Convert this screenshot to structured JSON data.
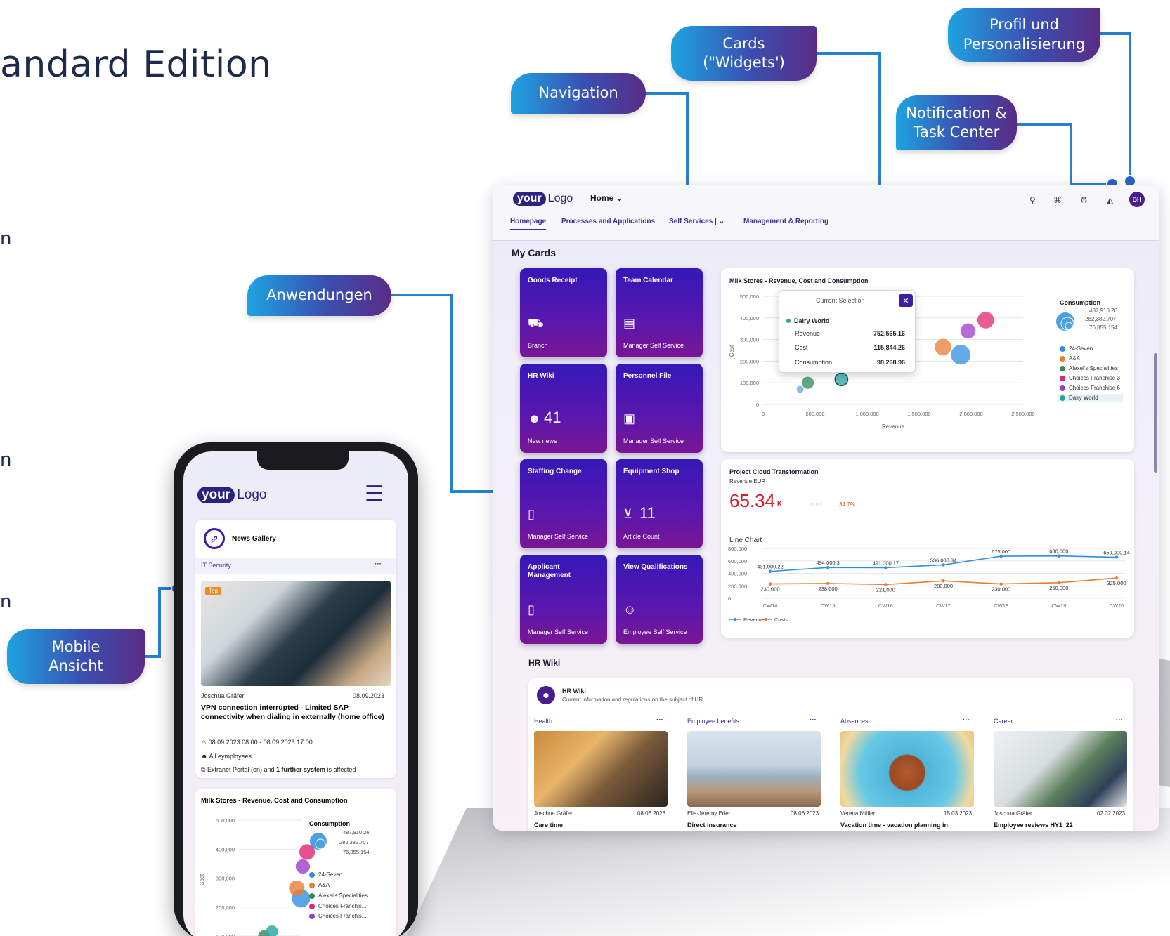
{
  "heading": "andard Edition",
  "edge_letters": [
    "n",
    "n",
    "n"
  ],
  "callouts": {
    "navigation": "Navigation",
    "cards": "Cards\n(\"Widgets')",
    "profile": "Profil und\nPersonalisierung",
    "notifications": "Notification &\nTask Center",
    "applications": "Anwendungen",
    "mobile": "Mobile\nAnsicht"
  },
  "desktop": {
    "logo": {
      "your": "your",
      "logo": "Logo"
    },
    "home_selector": "Home ⌄",
    "tabs": [
      "Homepage",
      "Processes and Applications",
      "Self Services  |  ⌄",
      "Management & Reporting"
    ],
    "avatar": "BH",
    "section_title": "My Cards",
    "tiles": [
      {
        "title": "Goods Receipt",
        "icon": "🚚",
        "number": "",
        "sub": "Branch"
      },
      {
        "title": "Team Calendar",
        "icon": "🗓",
        "number": "",
        "sub": "Manager Self Service"
      },
      {
        "title": "HR Wiki",
        "icon": "👥",
        "number": "41",
        "sub": "New news"
      },
      {
        "title": "Personnel File",
        "icon": "🗂",
        "number": "",
        "sub": "Manager Self Service"
      },
      {
        "title": "Staffing Change",
        "icon": "🗎",
        "number": "",
        "sub": "Manager Self Service"
      },
      {
        "title": "Equipment Shop",
        "icon": "🛒",
        "number": "11",
        "sub": "Article Count"
      },
      {
        "title": "Applicant Management",
        "icon": "🗎",
        "number": "",
        "sub": "Manager Self Service"
      },
      {
        "title": "View Qualifications",
        "icon": "👥",
        "number": "",
        "sub": "Employee Self Service"
      }
    ],
    "bubble_card": {
      "title": "Milk Stores - Revenue, Cost and Consumption",
      "popup": {
        "header": "Current Selection",
        "close": "✕",
        "name": "Dairy World",
        "rows": [
          {
            "label": "Revenue",
            "value": "752,565.16"
          },
          {
            "label": "Cost",
            "value": "115,844.26"
          },
          {
            "label": "Consumption",
            "value": "98,268.96"
          }
        ]
      },
      "y_ticks": [
        "500,000",
        "400,000",
        "300,000",
        "200,000",
        "100,000",
        "0"
      ],
      "x_ticks": [
        "0",
        "500,000",
        "1,000,000",
        "1,500,000",
        "2,000,000",
        "2,500,000"
      ],
      "y_label": "Cost",
      "x_label": "Revenue",
      "size_legend": {
        "title": "Consumption",
        "values": [
          "487,910.26",
          "282,382.707",
          "76,855.154"
        ]
      },
      "legend": [
        {
          "name": "24-Seven",
          "color": "#2f8fe0"
        },
        {
          "name": "A&A",
          "color": "#ea7c34"
        },
        {
          "name": "Alexei's Specialities",
          "color": "#2e8b57"
        },
        {
          "name": "Choices Franchise 3",
          "color": "#e0266f"
        },
        {
          "name": "Choices Franchise 6",
          "color": "#9b3cc9"
        },
        {
          "name": "Dairy World",
          "color": "#2aa3a0"
        }
      ]
    },
    "kpi_card": {
      "title": "Project Cloud Transformation",
      "subtitle": "Revenue  EUR",
      "value": "65.34",
      "unit": "K",
      "faint": "trust",
      "delta": "34.7%",
      "chart_title": "Line Chart"
    },
    "hr_wiki": {
      "section": "HR Wiki",
      "title": "HR Wiki",
      "subtitle": "Current information and regulations on the subject of HR",
      "columns": [
        {
          "title": "Health",
          "author": "Joschua Gräfer",
          "date": "08.06.2023",
          "headline": "Care time"
        },
        {
          "title": "Employee benefits",
          "author": "Elia-Jeremy Eder",
          "date": "08.06.2023",
          "headline": "Direct insurance"
        },
        {
          "title": "Absences",
          "author": "Verena Müller",
          "date": "15.03.2023",
          "headline": "Vacation time - vacation planning in"
        },
        {
          "title": "Career",
          "author": "Joschua Gräfer",
          "date": "02.02.2023",
          "headline": "Employee reviews HY1 '22"
        }
      ]
    }
  },
  "mobile": {
    "logo": {
      "your": "your",
      "logo": "Logo"
    },
    "news": {
      "title": "News Gallery",
      "category": "IT Security",
      "badge": "Top",
      "author": "Joschua Gräfer",
      "date": "08.09.2023",
      "headline": "VPN connection interrupted - Limited SAP connectivity when dialing in externally (home office)",
      "time": "08.09.2023 08:00 - 08.09.2023 17:00",
      "audience": "All eymployees",
      "systems_pre": "Extranet Portal (en) and ",
      "systems_bold": "1 further system",
      "systems_post": " is affected"
    },
    "chart": {
      "title": "Milk Stores - Revenue, Cost and Consumption",
      "y_ticks": [
        "500,000",
        "400,000",
        "300,000",
        "200,000",
        "100,000"
      ],
      "y_label": "Cost",
      "size_title": "Consumption",
      "size_values": [
        "487,910.26",
        "282,382.707",
        "76,855.154"
      ],
      "legend": [
        "24-Seven",
        "A&A",
        "Alexei's Specialities",
        "Choices Franchis...",
        "Choices Franchis..."
      ]
    }
  },
  "chart_data": [
    {
      "type": "scatter",
      "title": "Milk Stores - Revenue, Cost and Consumption",
      "xlabel": "Revenue",
      "ylabel": "Cost",
      "xlim": [
        0,
        2500000
      ],
      "ylim": [
        0,
        500000
      ],
      "series": [
        {
          "name": "24-Seven",
          "x": [
            1900000
          ],
          "y": [
            230000
          ],
          "size": [
            487910
          ]
        },
        {
          "name": "A&A",
          "x": [
            1730000
          ],
          "y": [
            265000
          ],
          "size": [
            282383
          ]
        },
        {
          "name": "Alexei's Specialities",
          "x": [
            430000
          ],
          "y": [
            100000
          ],
          "size": [
            76855
          ]
        },
        {
          "name": "Choices Franchise 3",
          "x": [
            2140000
          ],
          "y": [
            390000
          ],
          "size": [
            282383
          ]
        },
        {
          "name": "Choices Franchise 6",
          "x": [
            1970000
          ],
          "y": [
            340000
          ],
          "size": [
            200000
          ]
        },
        {
          "name": "Dairy World",
          "x": [
            752565
          ],
          "y": [
            115844
          ],
          "size": [
            98269
          ]
        }
      ]
    },
    {
      "type": "line",
      "title": "Line Chart",
      "categories": [
        "CW14",
        "CW15",
        "CW16",
        "CW17",
        "CW18",
        "CW19",
        "CW20"
      ],
      "ylim": [
        0,
        800000
      ],
      "y_ticks": [
        "800,000",
        "600,000",
        "400,000",
        "200,000",
        "0"
      ],
      "series": [
        {
          "name": "Revenue",
          "color": "#2f8fe0",
          "values": [
            431000.22,
            494000.3,
            491000.17,
            536000.34,
            675000,
            680000,
            659000.14
          ],
          "labels": [
            "431,000.22",
            "494,000.3",
            "491,000.17",
            "536,000.34",
            "675,000",
            "680,000",
            "659,000.14"
          ]
        },
        {
          "name": "Costs",
          "color": "#ea7c34",
          "values": [
            230000,
            238000,
            221000,
            280000,
            230000,
            250000,
            325000
          ],
          "labels": [
            "230,000",
            "238,000",
            "221,000",
            "280,000",
            "230,000",
            "250,000",
            "325,000"
          ]
        }
      ]
    }
  ]
}
